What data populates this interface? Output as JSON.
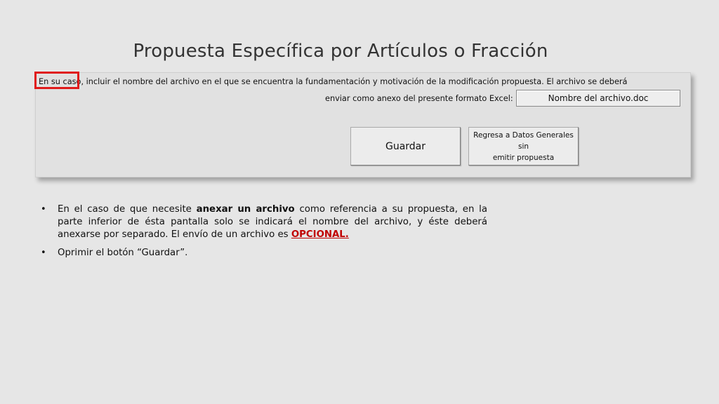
{
  "slide": {
    "title": "Propuesta Específica por Artículos o Fracción"
  },
  "form": {
    "instruction_line1": "En su caso, incluir el nombre del archivo en el que se encuentra la fundamentación y motivación de la modificación propuesta. El archivo se deberá",
    "instruction_line2": "enviar como anexo del presente formato Excel:",
    "filename_value": "Nombre del archivo.doc",
    "save_button_label": "Guardar",
    "return_button_line1": "Regresa a Datos Generales sin",
    "return_button_line2": "emitir propuesta"
  },
  "bullets": [
    {
      "marker": "•",
      "part1": "En el caso de que necesite ",
      "bold": "anexar un archivo",
      "part2": " como referencia a su propuesta, en la parte inferior de ésta pantalla solo se indicará el nombre del archivo, y éste deberá anexarse por separado. El envío de un archivo es ",
      "highlight": "OPCIONAL."
    },
    {
      "marker": "•",
      "text": "Oprimir el botón “Guardar”."
    }
  ],
  "colors": {
    "highlight_red": "#e01b1b",
    "optional_red": "#c00000",
    "background": "#e6e6e6"
  }
}
